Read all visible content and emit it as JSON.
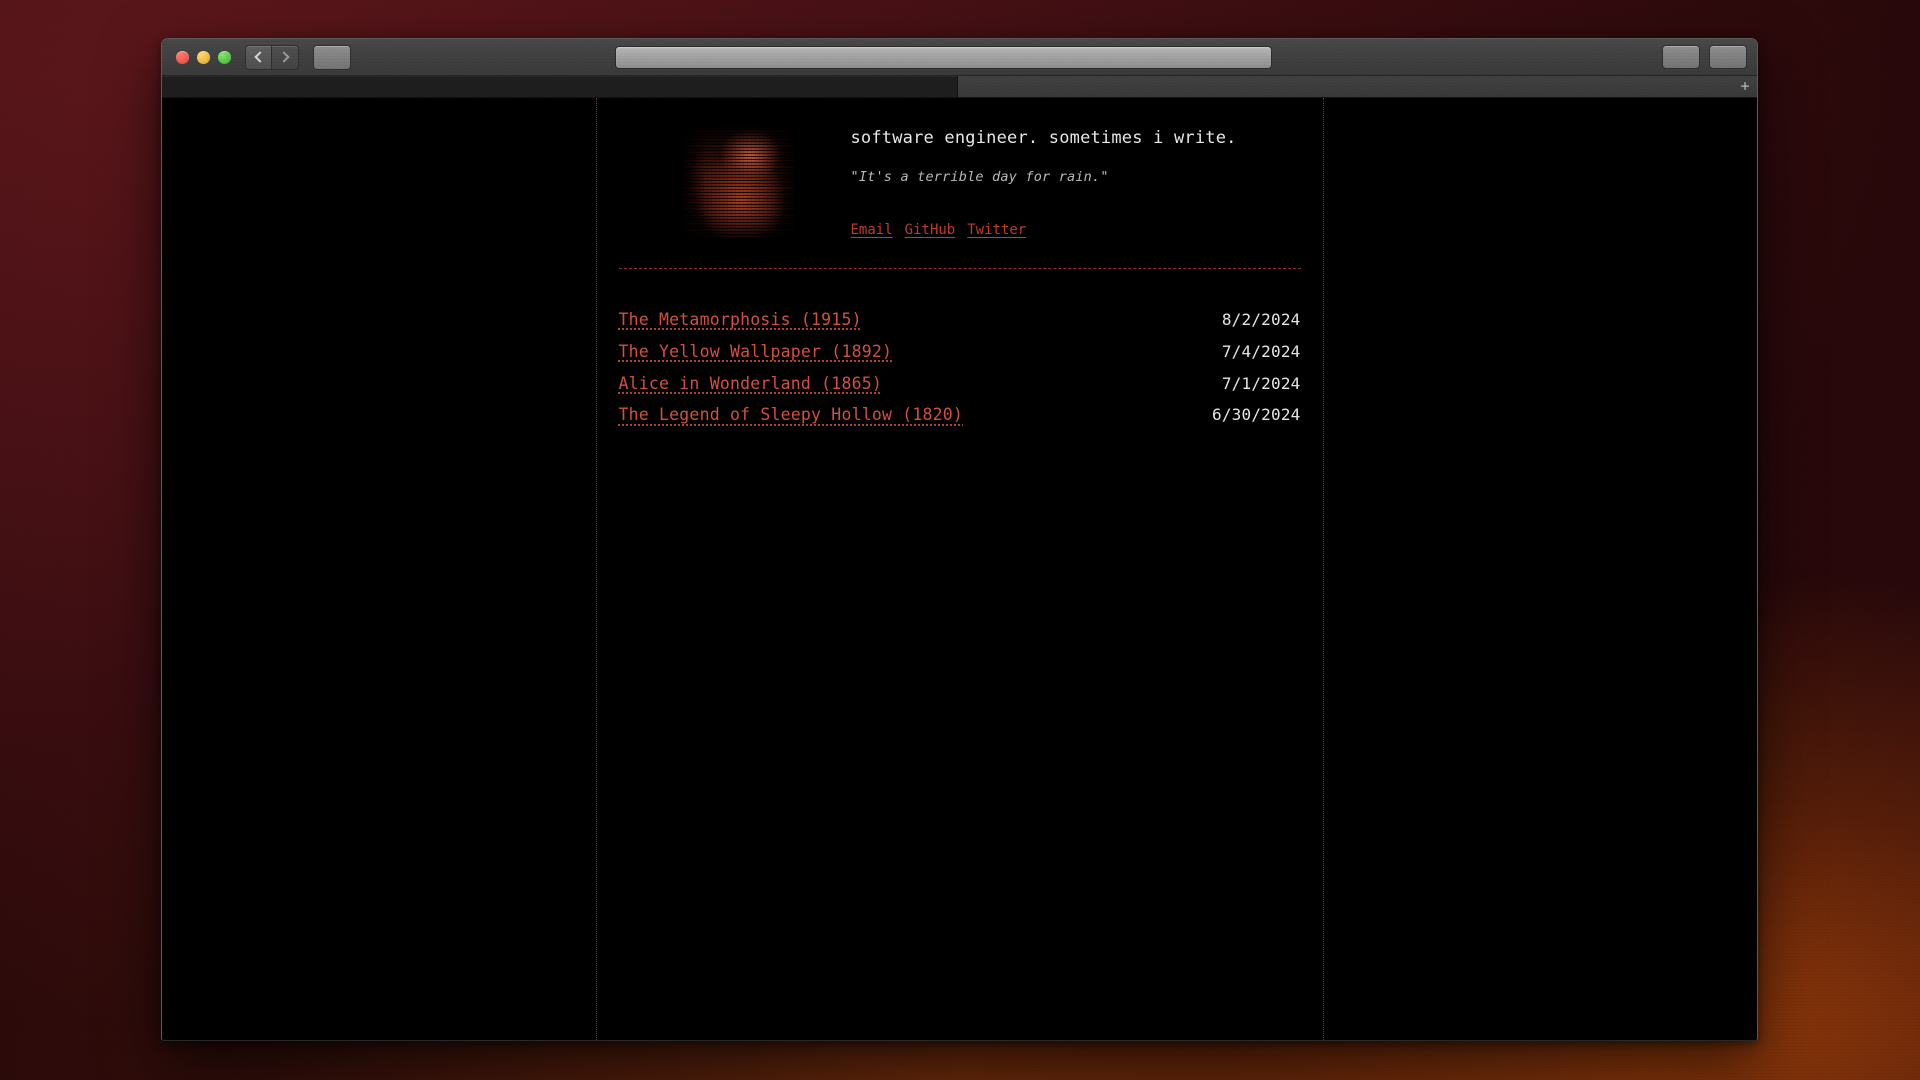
{
  "browser": {
    "window_controls": [
      {
        "name": "close",
        "color": "#e0443a"
      },
      {
        "name": "minimize",
        "color": "#dfa226"
      },
      {
        "name": "maximize",
        "color": "#35b12c"
      }
    ],
    "back_label": "",
    "forward_label": "",
    "url_value": "",
    "url_placeholder": "",
    "new_tab_label": "+",
    "tab_title": ""
  },
  "header": {
    "tagline": "software engineer. sometimes i write.",
    "quote": "\"It's a terrible day for rain.\"",
    "links": [
      {
        "label": "Email"
      },
      {
        "label": "GitHub"
      },
      {
        "label": "Twitter"
      }
    ],
    "avatar_alt": "glitch-portrait-avatar"
  },
  "posts": [
    {
      "title": "The Metamorphosis (1915)",
      "date": "8/2/2024"
    },
    {
      "title": "The Yellow Wallpaper (1892)",
      "date": "7/4/2024"
    },
    {
      "title": "Alice in Wonderland (1865)",
      "date": "7/1/2024"
    },
    {
      "title": "The Legend of Sleepy Hollow (1820)",
      "date": "6/30/2024"
    }
  ],
  "colors": {
    "link": "#bf3b2c",
    "post_title": "#d2513c",
    "date": "#e6e6e6",
    "border": "#8e2b22",
    "page_bg": "#000000"
  }
}
